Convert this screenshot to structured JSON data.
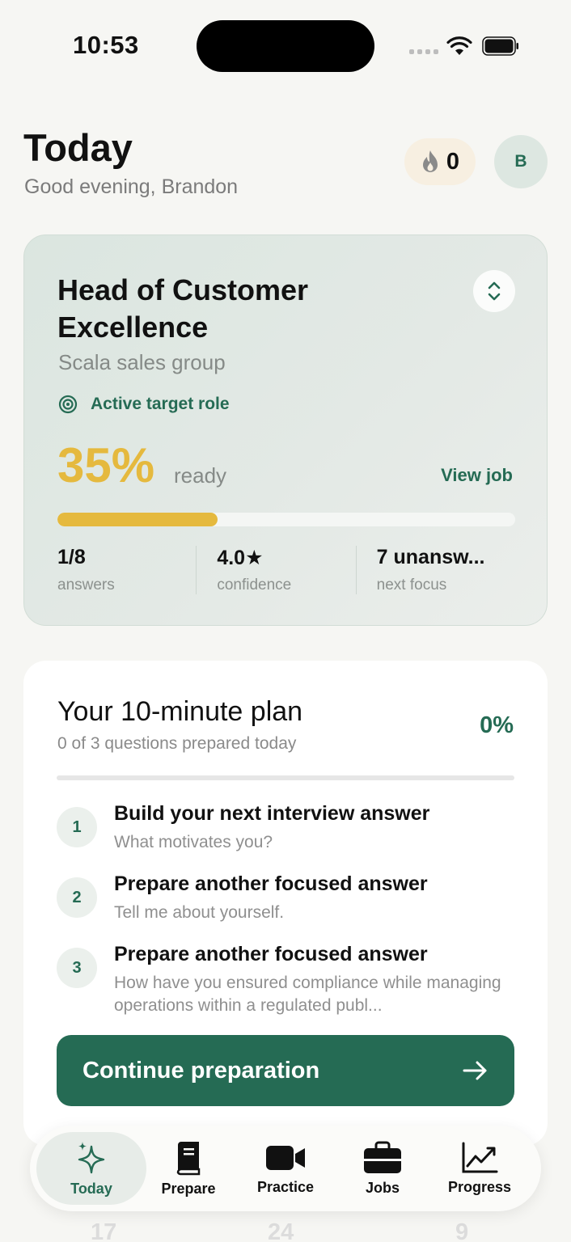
{
  "status_bar": {
    "time": "10:53"
  },
  "header": {
    "title": "Today",
    "greeting": "Good evening, Brandon",
    "streak_count": "0",
    "avatar_initial": "B"
  },
  "role_card": {
    "title": "Head of Customer Excellence",
    "company": "Scala sales group",
    "active_label": "Active target role",
    "readiness_pct": "35%",
    "readiness_fraction": 0.35,
    "ready_label": "ready",
    "view_job_label": "View job",
    "stats": [
      {
        "value": "1/8",
        "label": "answers"
      },
      {
        "value": "4.0★",
        "label": "confidence"
      },
      {
        "value": "7 unansw...",
        "label": "next focus"
      }
    ]
  },
  "plan": {
    "title": "Your 10-minute plan",
    "subtitle": "0 of 3 questions prepared today",
    "progress_pct": "0%",
    "items": [
      {
        "num": "1",
        "title": "Build your next interview answer",
        "subtitle": "What motivates you?"
      },
      {
        "num": "2",
        "title": "Prepare another focused answer",
        "subtitle": "Tell me about yourself."
      },
      {
        "num": "3",
        "title": "Prepare another focused answer",
        "subtitle": "How have you ensured compliance while managing operations within a regulated publ..."
      }
    ],
    "continue_label": "Continue preparation"
  },
  "tabbar": {
    "tabs": [
      {
        "label": "Today",
        "icon": "sparkles-icon",
        "active": true
      },
      {
        "label": "Prepare",
        "icon": "book-icon",
        "active": false
      },
      {
        "label": "Practice",
        "icon": "video-camera-icon",
        "active": false
      },
      {
        "label": "Jobs",
        "icon": "briefcase-icon",
        "active": false
      },
      {
        "label": "Progress",
        "icon": "chart-line-icon",
        "active": false
      }
    ]
  },
  "background_numbers": [
    "17",
    "24",
    "9"
  ],
  "colors": {
    "accent": "#256b54",
    "gold": "#e5b93e",
    "background": "#f6f6f3"
  }
}
